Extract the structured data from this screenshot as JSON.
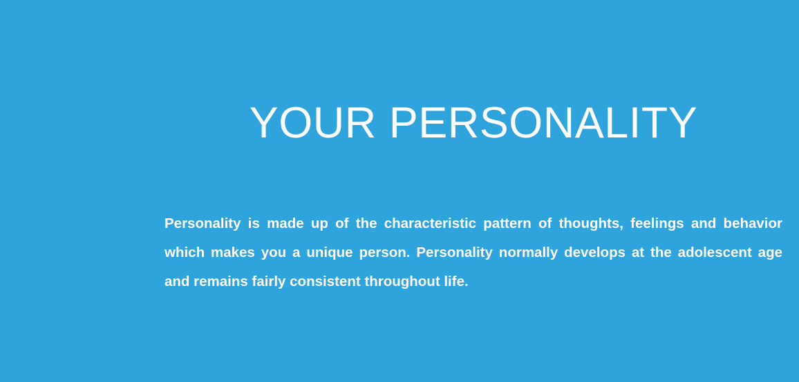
{
  "slide": {
    "title": "YOUR PERSONALITY",
    "body": "Personality is made up of the characteristic pattern of thoughts, feelings and behavior which makes you a unique person. Personality normally develops at the adolescent age and remains fairly consistent throughout life."
  },
  "colors": {
    "background": "#2ea3dc",
    "text": "#ffffff"
  }
}
